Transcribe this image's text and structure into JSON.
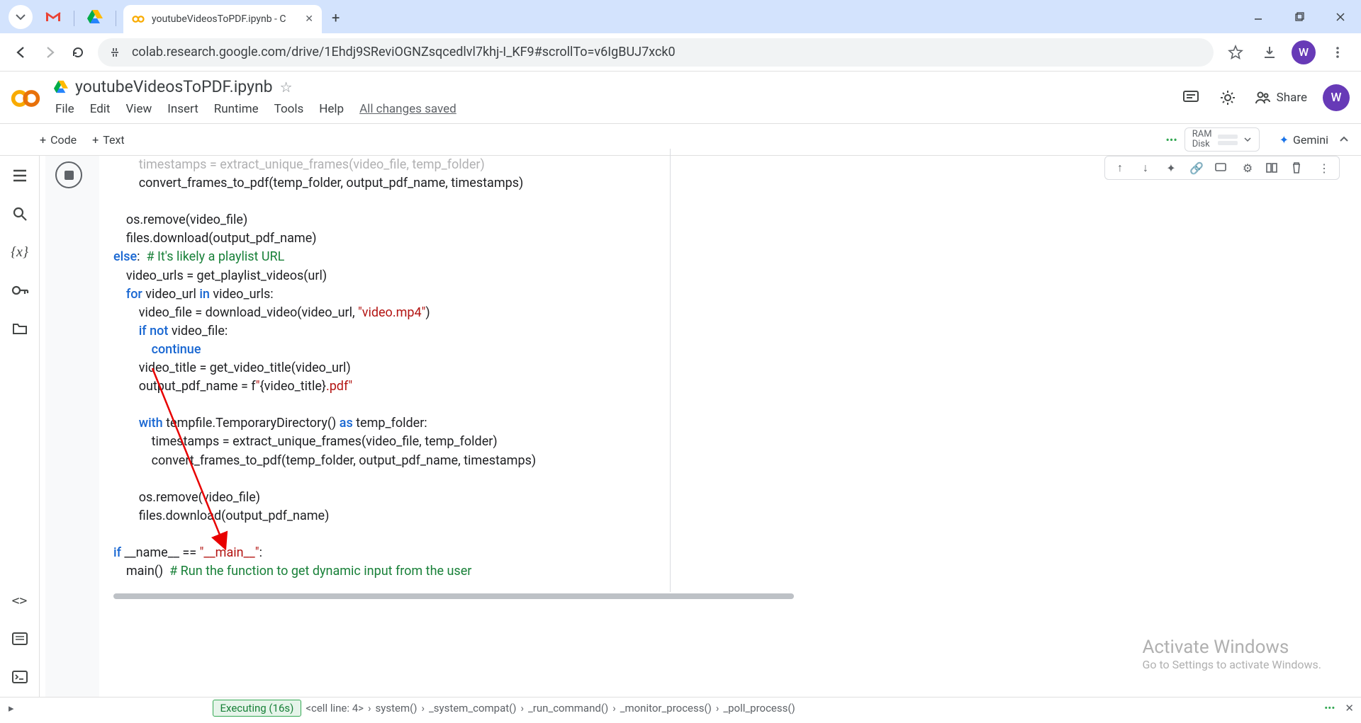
{
  "browser": {
    "tab_title": "youtubeVideosToPDF.ipynb - C",
    "url": "colab.research.google.com/drive/1Ehdj9SReviOGNZsqcedlvl7khj-I_KF9#scrollTo=v6IgBUJ7xck0",
    "avatar_letter": "W"
  },
  "colab": {
    "doc_title": "youtubeVideosToPDF.ipynb",
    "menu": {
      "file": "File",
      "edit": "Edit",
      "view": "View",
      "insert": "Insert",
      "runtime": "Runtime",
      "tools": "Tools",
      "help": "Help",
      "saved": "All changes saved"
    },
    "add_code": "Code",
    "add_text": "Text",
    "res": {
      "ram": "RAM",
      "disk": "Disk"
    },
    "gemini": "Gemini",
    "share": "Share",
    "avatar_letter": "W"
  },
  "code": {
    "l00a": "        timestamps = extract_unique_frames(video_file, temp_folder)",
    "l01": "        convert_frames_to_pdf(temp_folder, output_pdf_name, timestamps)",
    "l03": "    os.remove(video_file)",
    "l04": "    files.download(output_pdf_name)",
    "l05a_kw": "else",
    "l05a_rest": ":  ",
    "l05a_com": "# It's likely a playlist URL",
    "l06": "    video_urls = get_playlist_videos(url)",
    "l07_pre": "    ",
    "l07_kw": "for",
    "l07_mid": " video_url ",
    "l07_kw2": "in",
    "l07_post": " video_urls:",
    "l08_pre": "        video_file = download_video(video_url, ",
    "l08_str": "\"video.mp4\"",
    "l08_post": ")",
    "l09_pre": "        ",
    "l09_kw1": "if",
    "l09_mid": " ",
    "l09_kw2": "not",
    "l09_post": " video_file:",
    "l10_pre": "            ",
    "l10_kw": "continue",
    "l11": "        video_title = get_video_title(video_url)",
    "l12_pre": "        output_pdf_name = f",
    "l12_str1": "\"",
    "l12_in": "{video_title}",
    "l12_str2": ".pdf\"",
    "l14_pre": "        ",
    "l14_kw1": "with",
    "l14_mid": " tempfile.TemporaryDirectory() ",
    "l14_kw2": "as",
    "l14_post": " temp_folder:",
    "l15": "            timestamps = extract_unique_frames(video_file, temp_folder)",
    "l16": "            convert_frames_to_pdf(temp_folder, output_pdf_name, timestamps)",
    "l18": "        os.remove(video_file)",
    "l19": "        files.download(output_pdf_name)",
    "l21_kw": "if",
    "l21_mid": " __name__ == ",
    "l21_str": "\"__main__\"",
    "l21_post": ":",
    "l22_call": "    main()  ",
    "l22_com": "# Run the function to get dynamic input from the user"
  },
  "status": {
    "exec": "Executing (16s)",
    "crumbs": [
      "<cell line: 4>",
      "system()",
      "_system_compat()",
      "_run_command()",
      "_monitor_process()",
      "_poll_process()"
    ]
  },
  "watermark": {
    "t1": "Activate Windows",
    "t2": "Go to Settings to activate Windows."
  }
}
